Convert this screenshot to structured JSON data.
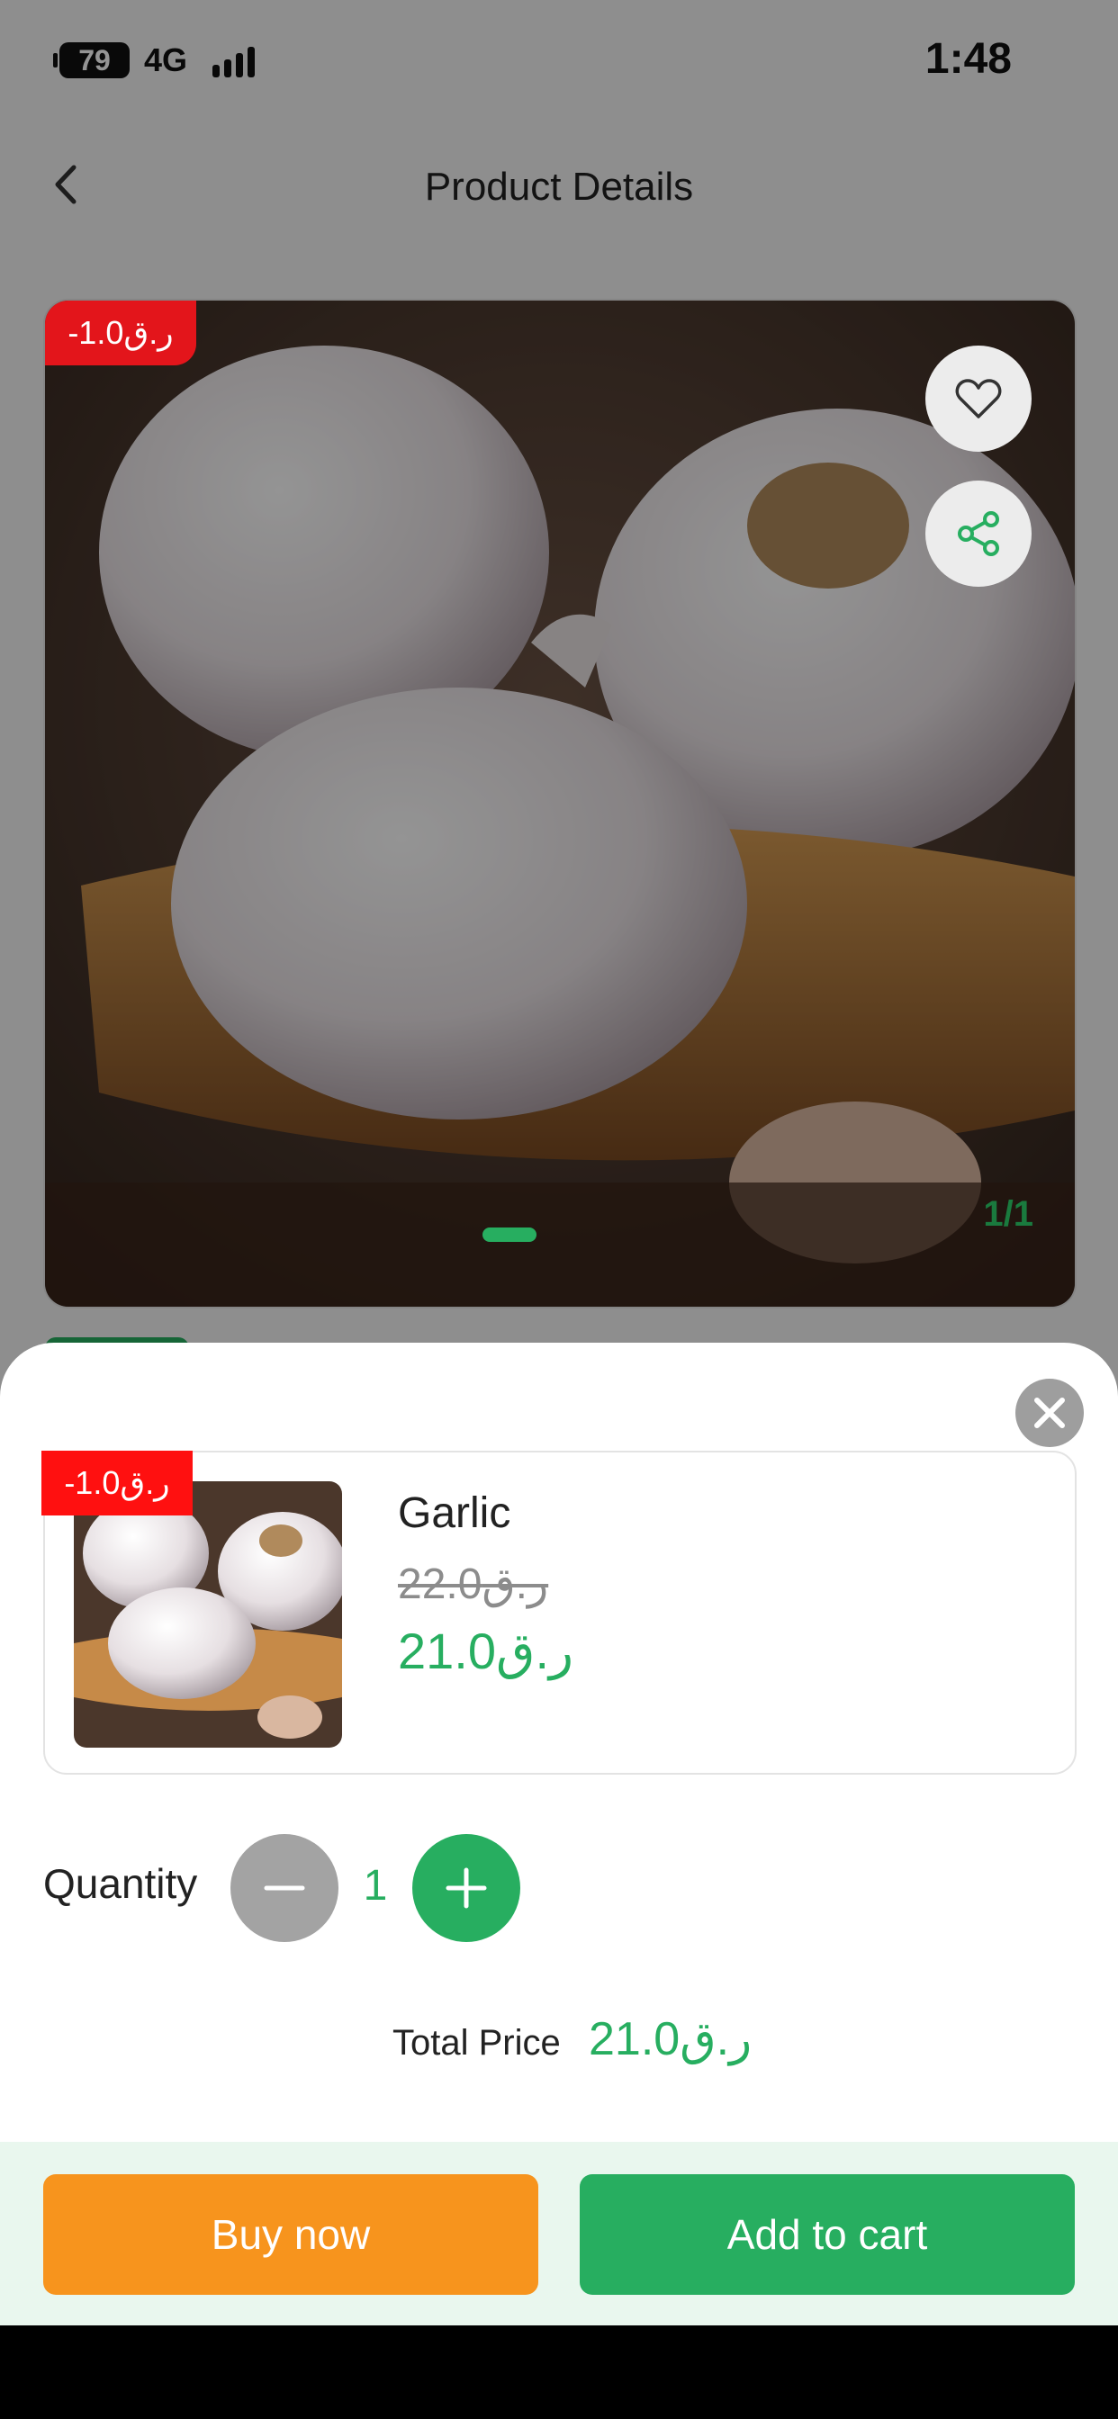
{
  "status_bar": {
    "battery": "79",
    "network": "4G",
    "time": "1:48"
  },
  "header": {
    "title": "Product Details"
  },
  "product_image": {
    "discount_badge": "-1.0ر.ق",
    "counter": "1/1"
  },
  "sheet": {
    "card": {
      "discount_badge": "-1.0ر.ق",
      "name": "Garlic",
      "original_price": "22.0ر.ق",
      "price": "21.0ر.ق"
    },
    "quantity": {
      "label": "Quantity",
      "value": "1"
    },
    "total": {
      "label": "Total Price",
      "value": "21.0ر.ق"
    },
    "buttons": {
      "buy_now": "Buy now",
      "add_to_cart": "Add to cart"
    }
  },
  "colors": {
    "accent_green": "#27ae60",
    "buy_orange": "#f7941d",
    "badge_red": "#ff1010"
  }
}
